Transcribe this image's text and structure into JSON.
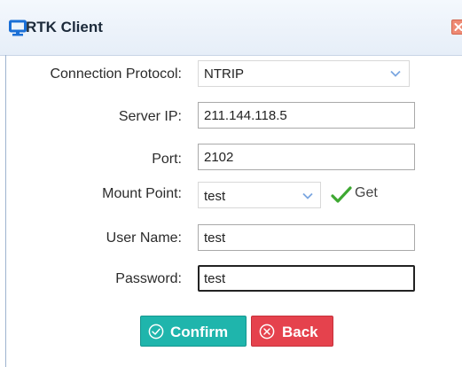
{
  "window": {
    "title": "RTK Client",
    "icon": "monitor-icon",
    "close_icon": "close-icon"
  },
  "form": {
    "protocol": {
      "label": "Connection Protocol:",
      "value": "NTRIP"
    },
    "server_ip": {
      "label": "Server IP:",
      "value": "211.144.118.5"
    },
    "port": {
      "label": "Port:",
      "value": "2102"
    },
    "mount_point": {
      "label": "Mount Point:",
      "value": "test",
      "get_label": "Get"
    },
    "user_name": {
      "label": "User Name:",
      "value": "test"
    },
    "password": {
      "label": "Password:",
      "value": "test"
    }
  },
  "buttons": {
    "confirm": "Confirm",
    "back": "Back"
  },
  "colors": {
    "confirm": "#1fb5ac",
    "back": "#e5424d",
    "title_icon": "#1a6fd6",
    "check": "#3ea832",
    "chevron": "#7aa6e0"
  }
}
